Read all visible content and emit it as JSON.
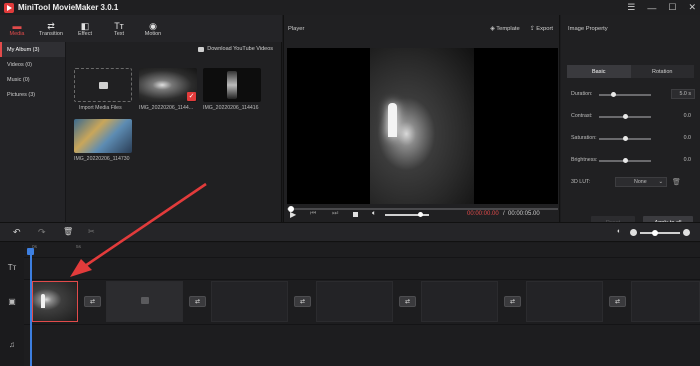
{
  "app": {
    "title": "MiniTool MovieMaker 3.0.1"
  },
  "window_controls": {
    "menu": "☰",
    "minimize": "—",
    "maximize": "☐",
    "close": "✕"
  },
  "toolbar": [
    {
      "label": "Media",
      "icon": "▬"
    },
    {
      "label": "Transition",
      "icon": "⇄"
    },
    {
      "label": "Effect",
      "icon": "◧"
    },
    {
      "label": "Text",
      "icon": "Tт"
    },
    {
      "label": "Motion",
      "icon": "◉"
    }
  ],
  "library": {
    "categories": [
      "My Album (3)",
      "Videos (0)",
      "Music (0)",
      "Pictures (3)"
    ],
    "download_link": "Download YouTube Videos",
    "import_label": "Import Media Files",
    "items": [
      {
        "label": "IMG_20220206_1144..."
      },
      {
        "label": "IMG_20220206_114416"
      },
      {
        "label": "IMG_20220206_114730"
      }
    ]
  },
  "player": {
    "title": "Player",
    "template_label": "Template",
    "export_label": "Export",
    "time_current": "00:00:00.00",
    "time_separator": "/",
    "time_total": "00:00:05.00",
    "progress_fraction": 0.0,
    "volume_fraction": 0.8
  },
  "property": {
    "title": "Image Property",
    "tabs": [
      "Basic",
      "Rotation"
    ],
    "duration_label": "Duration:",
    "duration_value": "5.0 s",
    "contrast_label": "Contrast:",
    "contrast_value": "0.0",
    "saturation_label": "Saturation:",
    "saturation_value": "0.0",
    "brightness_label": "Brightness:",
    "brightness_value": "0.0",
    "lut_label": "3D LUT:",
    "lut_value": "None",
    "reset_label": "Reset",
    "apply_all_label": "Apply to all"
  },
  "timeline": {
    "ruler_ticks": [
      "0s",
      "5s"
    ],
    "track_icons": {
      "text": "Tт",
      "video": "▣",
      "audio": "♫"
    }
  },
  "colors": {
    "accent": "#e24b4b",
    "playhead": "#3d7fe0"
  }
}
